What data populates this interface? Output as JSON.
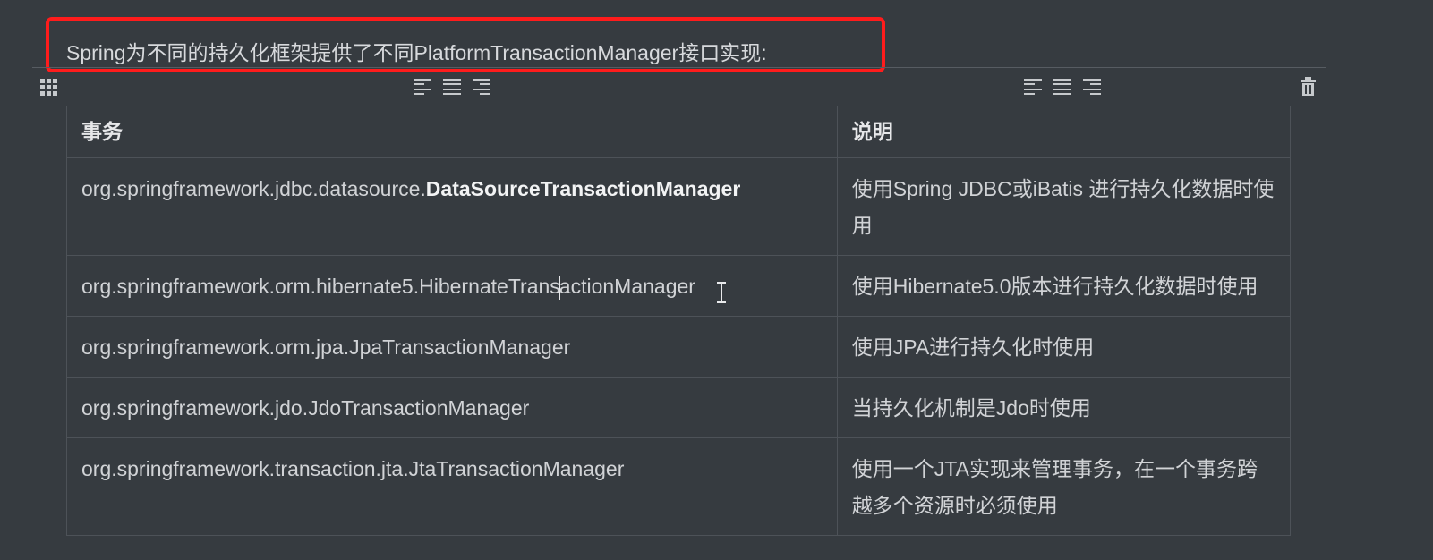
{
  "heading": {
    "text": "Spring为不同的持久化框架提供了不同PlatformTransactionManager接口实现:"
  },
  "colors": {
    "background": "#363b40",
    "highlight_border": "#ff1c1c",
    "text": "#d1d3d6"
  },
  "toolbar": {
    "icons": [
      "table-grid-icon",
      "align-left-icon",
      "align-center-icon",
      "align-right-icon",
      "delete-table-icon"
    ]
  },
  "table": {
    "headers": [
      "事务",
      "说明"
    ],
    "rows": [
      {
        "transaction_prefix": "org.springframework.jdbc.datasource.",
        "transaction_bold": "DataSourceTransactionManager",
        "description": "使用Spring JDBC或iBatis 进行持久化数据时使用"
      },
      {
        "transaction_before_caret": "org.springframework.orm.hibernate5.HibernateTrans",
        "transaction_after_caret": "actionManager",
        "description": "使用Hibernate5.0版本进行持久化数据时使用"
      },
      {
        "transaction": "org.springframework.orm.jpa.JpaTransactionManager",
        "description": "使用JPA进行持久化时使用"
      },
      {
        "transaction": "org.springframework.jdo.JdoTransactionManager",
        "description": "当持久化机制是Jdo时使用"
      },
      {
        "transaction": "org.springframework.transaction.jta.JtaTransactionManager",
        "description": "使用一个JTA实现来管理事务，在一个事务跨越多个资源时必须使用"
      }
    ]
  }
}
